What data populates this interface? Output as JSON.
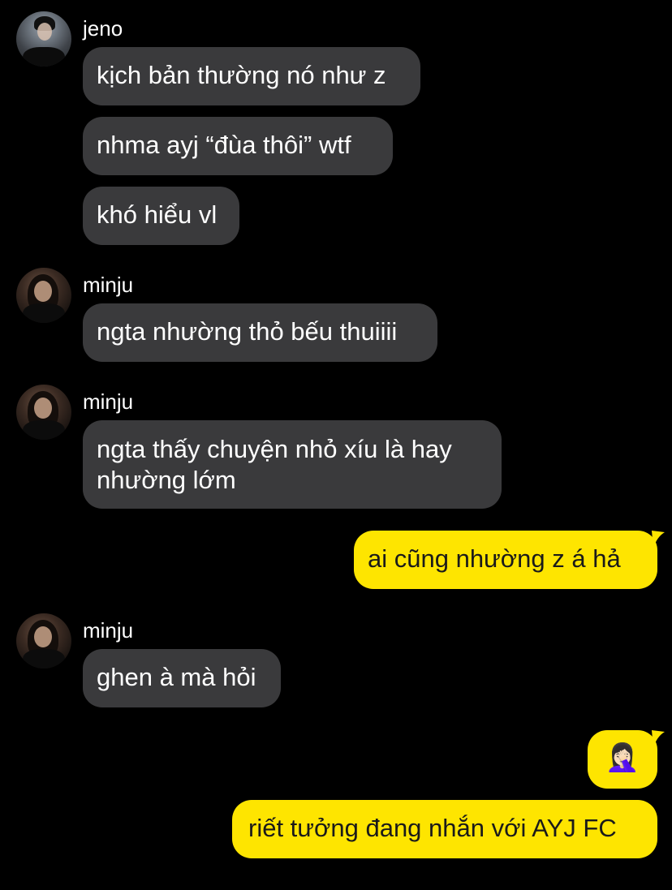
{
  "conversation": {
    "messages": [
      {
        "sender": "jeno",
        "text": "kịch bản thường nó như z"
      },
      {
        "sender": "jeno",
        "text": "nhma ayj “đùa thôi” wtf"
      },
      {
        "sender": "jeno",
        "text": "khó hiểu vl"
      },
      {
        "sender": "minju",
        "text": "ngta nhường thỏ bếu thuiiii"
      },
      {
        "sender": "minju",
        "text": "ngta thấy chuyện nhỏ xíu là hay nhường lớm"
      },
      {
        "sender": "me",
        "text": "ai cũng nhường z á hả"
      },
      {
        "sender": "minju",
        "text": "ghen à mà hỏi"
      },
      {
        "sender": "me",
        "text": "🤦🏻‍♀️"
      },
      {
        "sender": "me",
        "text": "riết tưởng đang nhắn với AYJ FC"
      }
    ],
    "names": {
      "jeno": "jeno",
      "minju": "minju"
    },
    "colors": {
      "background": "#000000",
      "incoming_bubble": "#3a3a3c",
      "outgoing_bubble": "#fee500",
      "outgoing_text": "#1a1a1a"
    }
  }
}
